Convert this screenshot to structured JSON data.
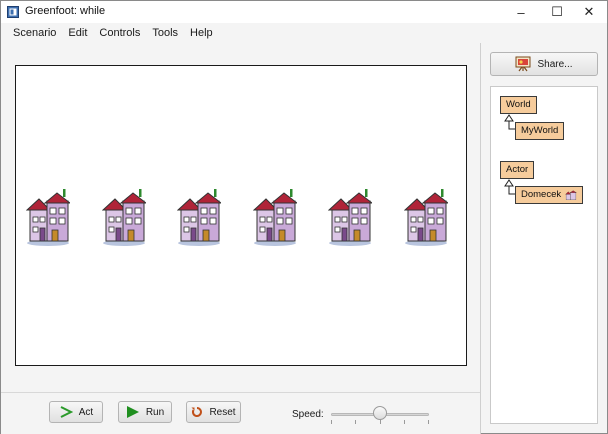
{
  "window": {
    "title": "Greenfoot: while",
    "minimize_glyph": "–",
    "maximize_glyph": "☐",
    "close_glyph": "✕"
  },
  "menu": {
    "items": [
      {
        "label": "Scenario"
      },
      {
        "label": "Edit"
      },
      {
        "label": "Controls"
      },
      {
        "label": "Tools"
      },
      {
        "label": "Help"
      }
    ]
  },
  "world": {
    "actor_icon": "house-icon",
    "actor_count": 6
  },
  "share": {
    "label": "Share...",
    "icon": "easel-icon"
  },
  "class_diagram": {
    "world_class": "World",
    "world_subclass": "MyWorld",
    "actor_class": "Actor",
    "actor_subclass": "Domecek"
  },
  "controls": {
    "act_label": "Act",
    "run_label": "Run",
    "reset_label": "Reset",
    "speed_label": "Speed:",
    "speed_fraction": 0.5
  },
  "colors": {
    "class_fill": "#f6cc9c",
    "act_arrow": "#2a9a2a",
    "run_arrow": "#1f8f1f",
    "reset_icon": "#c0501a"
  }
}
